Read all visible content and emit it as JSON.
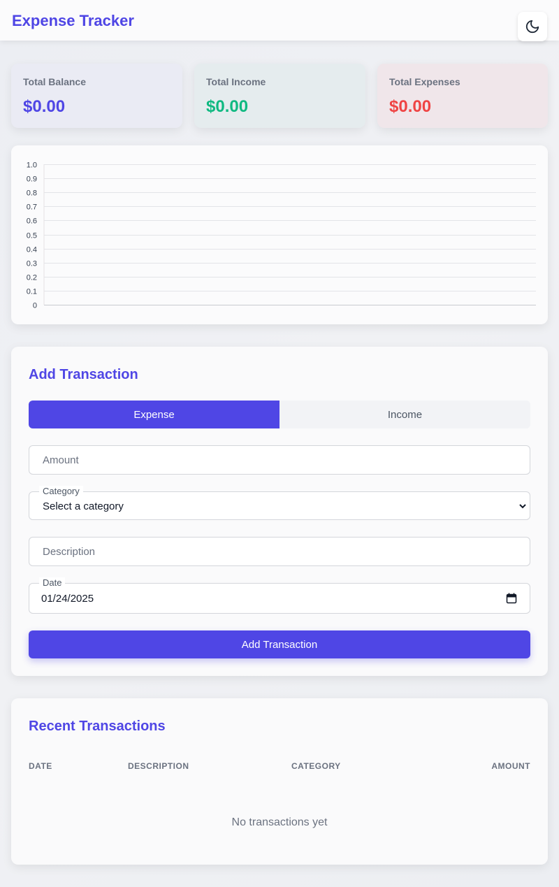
{
  "app": {
    "title": "Expense Tracker"
  },
  "header": {
    "theme_toggle_icon": "moon-icon"
  },
  "stats": [
    {
      "label": "Total Balance",
      "value": "$0.00",
      "color": "#4f46e5"
    },
    {
      "label": "Total Income",
      "value": "$0.00",
      "color": "#10b981"
    },
    {
      "label": "Total Expenses",
      "value": "$0.00",
      "color": "#ef4444"
    }
  ],
  "chart_data": {
    "type": "line",
    "title": "",
    "xlabel": "",
    "ylabel": "",
    "ylim": [
      0,
      1
    ],
    "yticks": [
      "1.0",
      "0.9",
      "0.8",
      "0.7",
      "0.6",
      "0.5",
      "0.4",
      "0.3",
      "0.2",
      "0.1",
      "0"
    ],
    "categories": [],
    "series": [],
    "grid": true
  },
  "form": {
    "title": "Add Transaction",
    "type_options": [
      "Expense",
      "Income"
    ],
    "selected_type": "Expense",
    "amount_placeholder": "Amount",
    "category_label": "Category",
    "category_value": "Select a category",
    "description_placeholder": "Description",
    "date_label": "Date",
    "date_value": "01/24/2025",
    "submit_label": "Add Transaction"
  },
  "transactions": {
    "title": "Recent Transactions",
    "columns": [
      "DATE",
      "DESCRIPTION",
      "CATEGORY",
      "AMOUNT"
    ],
    "rows": [],
    "empty_message": "No transactions yet"
  },
  "colors": {
    "accent": "#4f46e5",
    "income": "#10b981",
    "expense": "#ef4444"
  }
}
